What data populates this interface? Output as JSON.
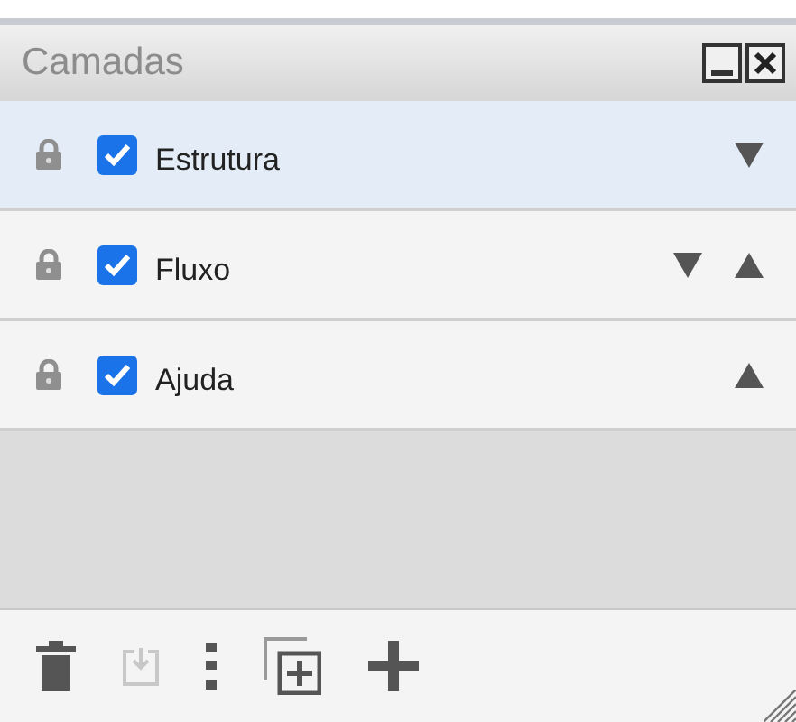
{
  "panel": {
    "title": "Camadas"
  },
  "layers": [
    {
      "name": "Estrutura",
      "selected": true,
      "checked": true,
      "can_move_down": true,
      "can_move_up": false
    },
    {
      "name": "Fluxo",
      "selected": false,
      "checked": true,
      "can_move_down": true,
      "can_move_up": true
    },
    {
      "name": "Ajuda",
      "selected": false,
      "checked": true,
      "can_move_down": false,
      "can_move_up": true
    }
  ],
  "toolbar": [
    {
      "kind": "delete",
      "disabled": false
    },
    {
      "kind": "merge",
      "disabled": true
    },
    {
      "kind": "more",
      "disabled": false
    },
    {
      "kind": "duplicate",
      "disabled": false
    },
    {
      "kind": "add",
      "disabled": false
    }
  ]
}
